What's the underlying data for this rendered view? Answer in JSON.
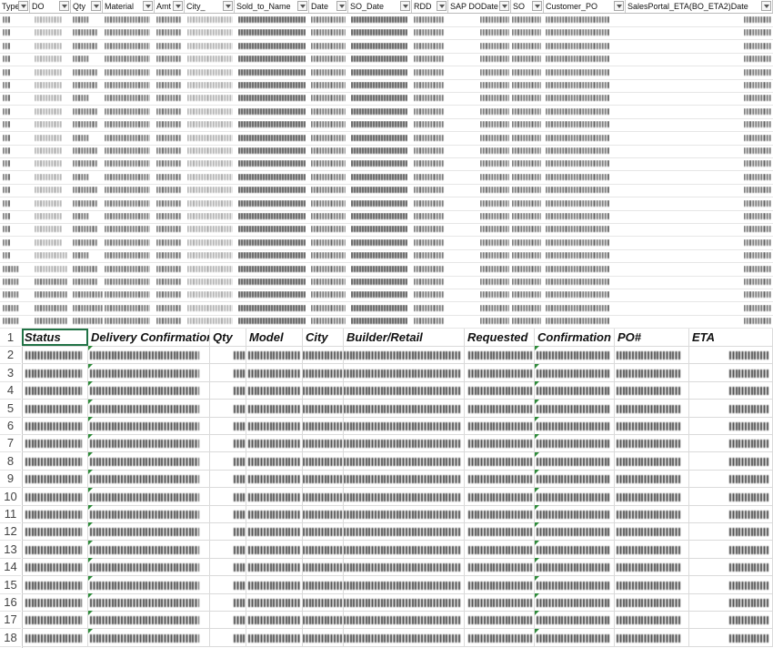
{
  "top_table": {
    "headers": [
      {
        "label": "Type"
      },
      {
        "label": "DO"
      },
      {
        "label": "Qty"
      },
      {
        "label": "Material"
      },
      {
        "label": "Amt"
      },
      {
        "label": "City_"
      },
      {
        "label": "Sold_to_Name"
      },
      {
        "label": "Date"
      },
      {
        "label": "SO_Date"
      },
      {
        "label": "RDD"
      },
      {
        "label": "SAP DODate"
      },
      {
        "label": "SO"
      },
      {
        "label": "Customer_PO"
      },
      {
        "label": "SalesPortal_ETA(BO_ETA2)Date"
      }
    ],
    "row_count": 24
  },
  "bottom_table": {
    "headers": {
      "status": "Status",
      "delivery_confirmation": "Delivery Confirmation",
      "qty": "Qty",
      "model": "Model",
      "city": "City",
      "builder_retail": "Builder/Retail",
      "requested": "Requested",
      "confirmation": "Confirmation",
      "po": "PO#",
      "eta": "ETA"
    },
    "row_numbers": [
      "1",
      "2",
      "3",
      "4",
      "5",
      "6",
      "7",
      "8",
      "9",
      "10",
      "11",
      "12",
      "13",
      "14",
      "15",
      "16",
      "17",
      "18"
    ],
    "eta_values": [
      "'̈'",
      "",
      "",
      "",
      "",
      "",
      "",
      "",
      "",
      "",
      "",
      "",
      "",
      "",
      "",
      "",
      "",
      ""
    ],
    "selected_cell": "A1"
  },
  "colors": {
    "grid_line": "#dadada",
    "selection_border": "#217346",
    "comment_marker": "#2e8b3a"
  }
}
